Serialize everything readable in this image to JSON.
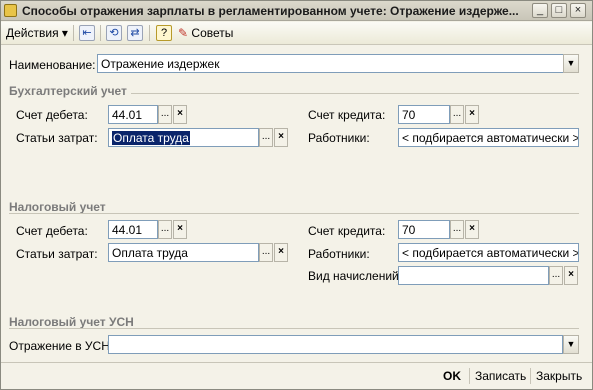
{
  "window": {
    "title": "Способы отражения зарплаты в регламентированном учете: Отражение издерже...",
    "minimize_glyph": "_",
    "maximize_glyph": "□",
    "close_glyph": "×"
  },
  "toolbar": {
    "actions_label": "Действия",
    "actions_arrow": "▾",
    "help_glyph": "?",
    "tips_label": "Советы"
  },
  "form": {
    "name_label": "Наименование:",
    "name_value": "Отражение издержек"
  },
  "accounting": {
    "section_title": "Бухгалтерский учет",
    "debit_label": "Счет дебета:",
    "debit_value": "44.01",
    "cost_label": "Статьи затрат:",
    "cost_value": "Оплата труда",
    "credit_label": "Счет кредита:",
    "credit_value": "70",
    "workers_label": "Работники:",
    "workers_value": "< подбирается автоматически >"
  },
  "tax": {
    "section_title": "Налоговый учет",
    "debit_label": "Счет дебета:",
    "debit_value": "44.01",
    "cost_label": "Статьи затрат:",
    "cost_value": "Оплата труда",
    "credit_label": "Счет кредита:",
    "credit_value": "70",
    "workers_label": "Работники:",
    "workers_value": "< подбирается автоматически >",
    "accrual_label": "Вид начислений:",
    "accrual_value": ""
  },
  "usn": {
    "section_title": "Налоговый учет УСН",
    "reflection_label": "Отражение в УСН:",
    "reflection_value": ""
  },
  "buttons": {
    "ok": "OK",
    "save": "Записать",
    "close": "Закрыть"
  },
  "field_buttons": {
    "select": "...",
    "clear": "×",
    "dropdown": "▼"
  }
}
